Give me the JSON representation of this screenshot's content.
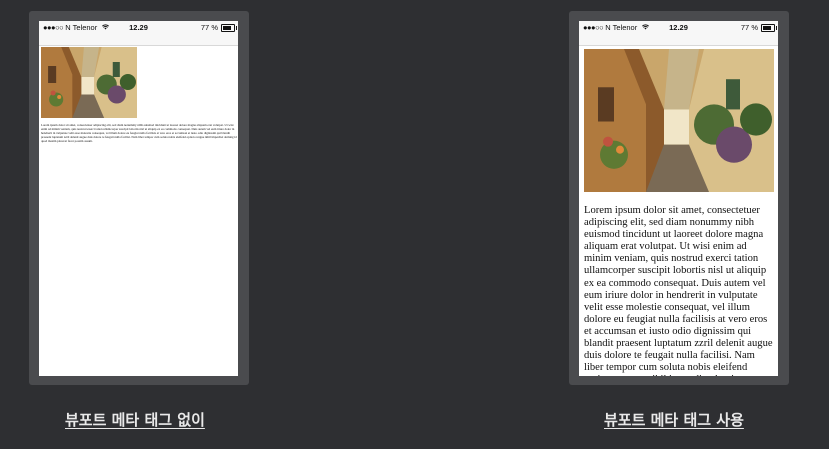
{
  "status_bar": {
    "signal": "●●●○○",
    "carrier": "N Telenor",
    "time": "12.29",
    "battery": "77 %",
    "battery_level": 0.77,
    "icons": [
      "signal-icon",
      "wifi-icon",
      "battery-icon"
    ]
  },
  "example_without_meta": {
    "caption": "뷰포트 메타 태그 없이",
    "body_text": "Lorem ipsum dolor sit amet, consectetuer adipiscing elit, sed diam nonummy nibh euismod tincidunt ut laoreet dolore magna aliquam erat volutpat. Ut wisi enim ad minim veniam, quis nostrud exerci tation ullamcorper suscipit lobortis nisl ut aliquip ex ea commodo consequat. Duis autem vel eum iriure dolor in hendrerit in vulputate velit esse molestie consequat, vel illum dolore eu feugiat nulla facilisis at vero eros et accumsan et iusto odio dignissim qui blandit praesent luptatum zzril delenit augue duis dolore te feugait nulla facilisi. Nam liber tempor cum soluta nobis eleifend option congue nihil imperdiet doming id quod mazim placerat facer possim assum."
  },
  "example_with_meta": {
    "caption": "뷰포트 메타 태그 사용",
    "body_text": "Lorem ipsum dolor sit amet, consectetuer adipiscing elit, sed diam nonummy nibh euismod tincidunt ut laoreet dolore magna aliquam erat volutpat. Ut wisi enim ad minim veniam, quis nostrud exerci tation ullamcorper suscipit lobortis nisl ut aliquip ex ea commodo consequat. Duis autem vel eum iriure dolor in hendrerit in vulputate velit esse molestie consequat, vel illum dolore eu feugiat nulla facilisis at vero eros et accumsan et iusto odio dignissim qui blandit praesent luptatum zzril delenit augue duis dolore te feugait nulla facilisi. Nam liber tempor cum soluta nobis eleifend option congue nihil imperdiet doming"
  },
  "colors": {
    "page_background": "#2e2f32",
    "panel_frame": "#4a4b4e",
    "caption_text": "#e9e9e9"
  }
}
